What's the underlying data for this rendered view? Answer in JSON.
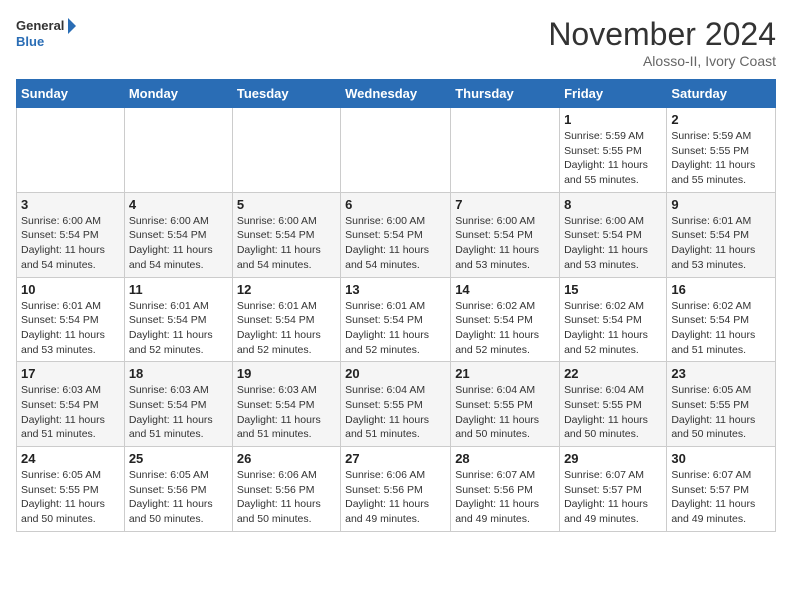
{
  "logo": {
    "line1": "General",
    "line2": "Blue"
  },
  "header": {
    "month": "November 2024",
    "location": "Alosso-II, Ivory Coast"
  },
  "weekdays": [
    "Sunday",
    "Monday",
    "Tuesday",
    "Wednesday",
    "Thursday",
    "Friday",
    "Saturday"
  ],
  "weeks": [
    [
      {
        "day": "",
        "info": ""
      },
      {
        "day": "",
        "info": ""
      },
      {
        "day": "",
        "info": ""
      },
      {
        "day": "",
        "info": ""
      },
      {
        "day": "",
        "info": ""
      },
      {
        "day": "1",
        "info": "Sunrise: 5:59 AM\nSunset: 5:55 PM\nDaylight: 11 hours\nand 55 minutes."
      },
      {
        "day": "2",
        "info": "Sunrise: 5:59 AM\nSunset: 5:55 PM\nDaylight: 11 hours\nand 55 minutes."
      }
    ],
    [
      {
        "day": "3",
        "info": "Sunrise: 6:00 AM\nSunset: 5:54 PM\nDaylight: 11 hours\nand 54 minutes."
      },
      {
        "day": "4",
        "info": "Sunrise: 6:00 AM\nSunset: 5:54 PM\nDaylight: 11 hours\nand 54 minutes."
      },
      {
        "day": "5",
        "info": "Sunrise: 6:00 AM\nSunset: 5:54 PM\nDaylight: 11 hours\nand 54 minutes."
      },
      {
        "day": "6",
        "info": "Sunrise: 6:00 AM\nSunset: 5:54 PM\nDaylight: 11 hours\nand 54 minutes."
      },
      {
        "day": "7",
        "info": "Sunrise: 6:00 AM\nSunset: 5:54 PM\nDaylight: 11 hours\nand 53 minutes."
      },
      {
        "day": "8",
        "info": "Sunrise: 6:00 AM\nSunset: 5:54 PM\nDaylight: 11 hours\nand 53 minutes."
      },
      {
        "day": "9",
        "info": "Sunrise: 6:01 AM\nSunset: 5:54 PM\nDaylight: 11 hours\nand 53 minutes."
      }
    ],
    [
      {
        "day": "10",
        "info": "Sunrise: 6:01 AM\nSunset: 5:54 PM\nDaylight: 11 hours\nand 53 minutes."
      },
      {
        "day": "11",
        "info": "Sunrise: 6:01 AM\nSunset: 5:54 PM\nDaylight: 11 hours\nand 52 minutes."
      },
      {
        "day": "12",
        "info": "Sunrise: 6:01 AM\nSunset: 5:54 PM\nDaylight: 11 hours\nand 52 minutes."
      },
      {
        "day": "13",
        "info": "Sunrise: 6:01 AM\nSunset: 5:54 PM\nDaylight: 11 hours\nand 52 minutes."
      },
      {
        "day": "14",
        "info": "Sunrise: 6:02 AM\nSunset: 5:54 PM\nDaylight: 11 hours\nand 52 minutes."
      },
      {
        "day": "15",
        "info": "Sunrise: 6:02 AM\nSunset: 5:54 PM\nDaylight: 11 hours\nand 52 minutes."
      },
      {
        "day": "16",
        "info": "Sunrise: 6:02 AM\nSunset: 5:54 PM\nDaylight: 11 hours\nand 51 minutes."
      }
    ],
    [
      {
        "day": "17",
        "info": "Sunrise: 6:03 AM\nSunset: 5:54 PM\nDaylight: 11 hours\nand 51 minutes."
      },
      {
        "day": "18",
        "info": "Sunrise: 6:03 AM\nSunset: 5:54 PM\nDaylight: 11 hours\nand 51 minutes."
      },
      {
        "day": "19",
        "info": "Sunrise: 6:03 AM\nSunset: 5:54 PM\nDaylight: 11 hours\nand 51 minutes."
      },
      {
        "day": "20",
        "info": "Sunrise: 6:04 AM\nSunset: 5:55 PM\nDaylight: 11 hours\nand 51 minutes."
      },
      {
        "day": "21",
        "info": "Sunrise: 6:04 AM\nSunset: 5:55 PM\nDaylight: 11 hours\nand 50 minutes."
      },
      {
        "day": "22",
        "info": "Sunrise: 6:04 AM\nSunset: 5:55 PM\nDaylight: 11 hours\nand 50 minutes."
      },
      {
        "day": "23",
        "info": "Sunrise: 6:05 AM\nSunset: 5:55 PM\nDaylight: 11 hours\nand 50 minutes."
      }
    ],
    [
      {
        "day": "24",
        "info": "Sunrise: 6:05 AM\nSunset: 5:55 PM\nDaylight: 11 hours\nand 50 minutes."
      },
      {
        "day": "25",
        "info": "Sunrise: 6:05 AM\nSunset: 5:56 PM\nDaylight: 11 hours\nand 50 minutes."
      },
      {
        "day": "26",
        "info": "Sunrise: 6:06 AM\nSunset: 5:56 PM\nDaylight: 11 hours\nand 50 minutes."
      },
      {
        "day": "27",
        "info": "Sunrise: 6:06 AM\nSunset: 5:56 PM\nDaylight: 11 hours\nand 49 minutes."
      },
      {
        "day": "28",
        "info": "Sunrise: 6:07 AM\nSunset: 5:56 PM\nDaylight: 11 hours\nand 49 minutes."
      },
      {
        "day": "29",
        "info": "Sunrise: 6:07 AM\nSunset: 5:57 PM\nDaylight: 11 hours\nand 49 minutes."
      },
      {
        "day": "30",
        "info": "Sunrise: 6:07 AM\nSunset: 5:57 PM\nDaylight: 11 hours\nand 49 minutes."
      }
    ]
  ]
}
